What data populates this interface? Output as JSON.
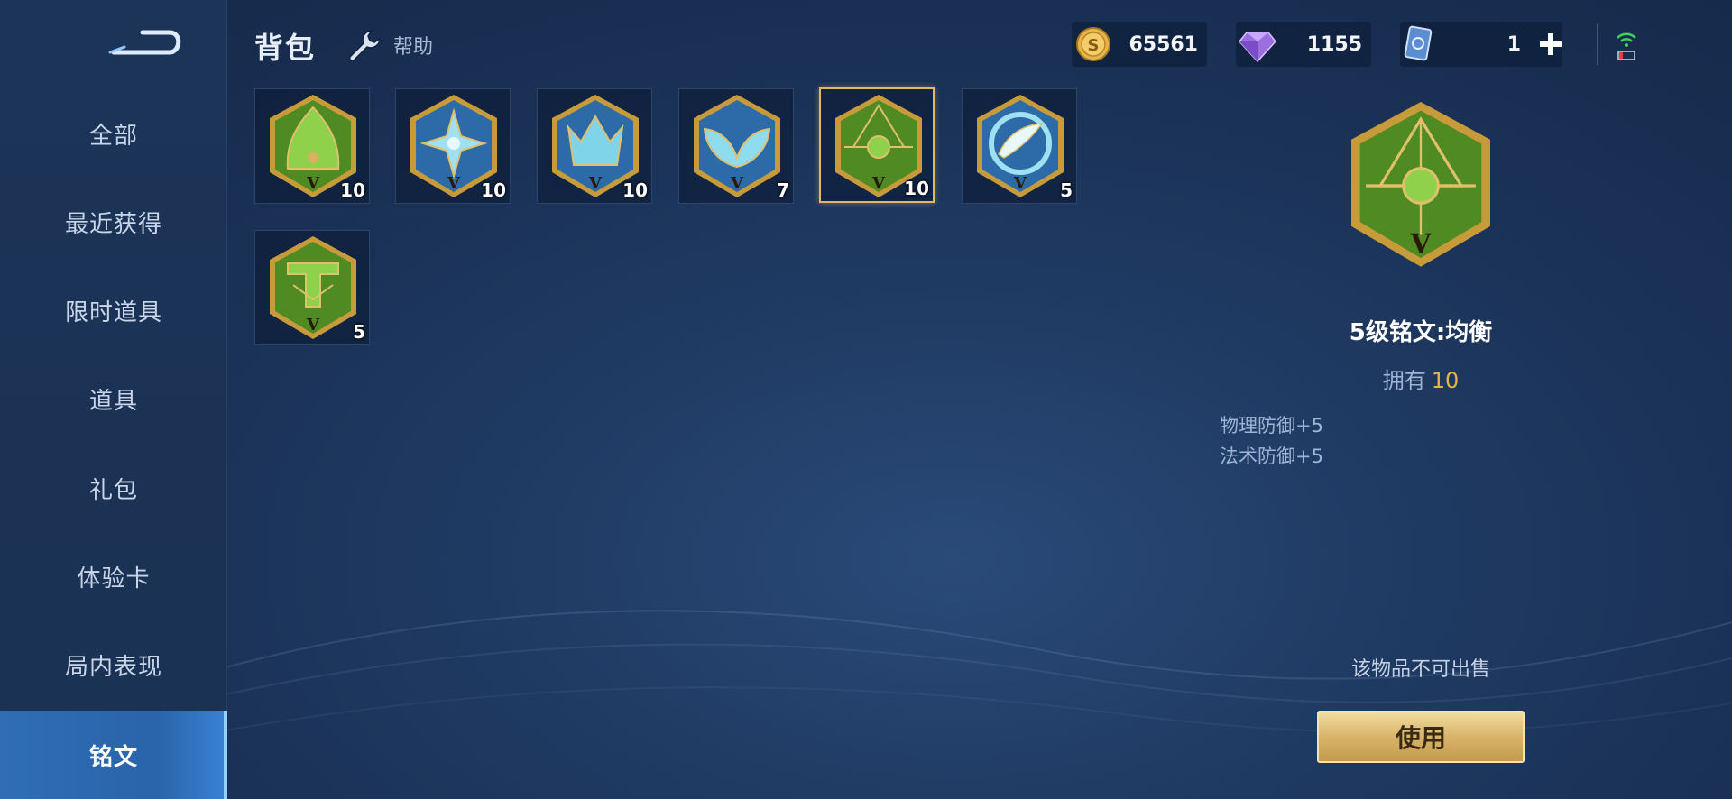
{
  "header": {
    "title": "背包",
    "help_label": "帮助",
    "currencies": [
      {
        "name": "gold-coin",
        "value": "65561"
      },
      {
        "name": "diamond",
        "value": "1155"
      },
      {
        "name": "card",
        "value": "1"
      }
    ]
  },
  "sidebar": {
    "items": [
      {
        "label": "全部"
      },
      {
        "label": "最近获得"
      },
      {
        "label": "限时道具"
      },
      {
        "label": "道具"
      },
      {
        "label": "礼包"
      },
      {
        "label": "体验卡"
      },
      {
        "label": "局内表现"
      },
      {
        "label": "铭文",
        "active": true
      }
    ]
  },
  "inventory": [
    {
      "color": "green",
      "icon": "inscription-green-arch-icon",
      "count": "10"
    },
    {
      "color": "blue",
      "icon": "inscription-blue-star-icon",
      "count": "10"
    },
    {
      "color": "blue",
      "icon": "inscription-blue-crown-icon",
      "count": "10"
    },
    {
      "color": "blue",
      "icon": "inscription-blue-wing-icon",
      "count": "7"
    },
    {
      "color": "green",
      "icon": "inscription-green-balance-icon",
      "count": "10",
      "selected": true
    },
    {
      "color": "blue",
      "icon": "inscription-blue-ring-icon",
      "count": "5"
    },
    {
      "color": "green",
      "icon": "inscription-green-gate-icon",
      "count": "5"
    }
  ],
  "detail": {
    "name": "5级铭文:均衡",
    "owned_label": "拥有",
    "owned_count": "10",
    "attributes": [
      "物理防御+5",
      "法术防御+5"
    ],
    "sell_note": "该物品不可出售",
    "use_label": "使用",
    "tier_glyph": "V"
  },
  "colors": {
    "gold": "#d9b25e",
    "green": "#5a9a2a",
    "blue": "#3b7bbd",
    "active_nav": "#2f6db5"
  }
}
